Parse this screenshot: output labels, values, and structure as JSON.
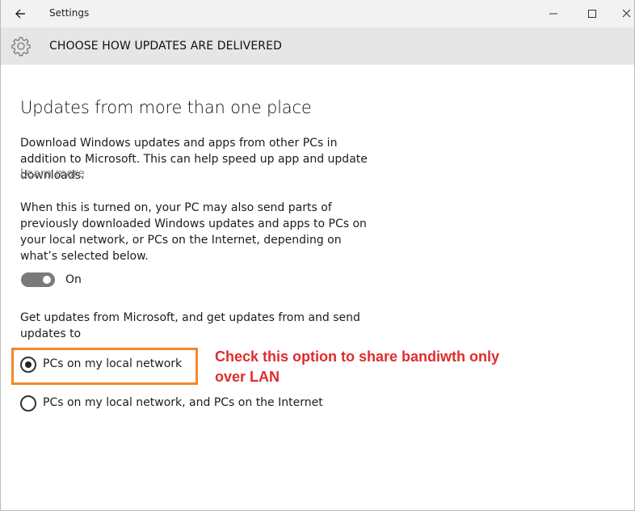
{
  "window": {
    "title": "Settings"
  },
  "icons": {
    "back": "back-arrow-icon",
    "minimize": "minimize-icon",
    "maximize": "maximize-icon",
    "close": "close-icon",
    "settings": "gear-icon"
  },
  "header": {
    "title": "CHOOSE HOW UPDATES ARE DELIVERED"
  },
  "content": {
    "heading": "Updates from more than one place",
    "description": "Download Windows updates and apps from other PCs in addition to Microsoft. This can help speed up app and update downloads.",
    "learn_more": "Learn more",
    "send_note": "When this is turned on, your PC may also send parts of previously downloaded Windows updates and apps to PCs on your local network, or PCs on the Internet, depending on what’s selected below.",
    "toggle": {
      "state": "On",
      "checked": true
    },
    "options_intro": "Get updates from Microsoft, and get updates from and send updates to",
    "options": [
      {
        "label": "PCs on my local network",
        "selected": true
      },
      {
        "label": "PCs on my local network, and PCs on the Internet",
        "selected": false
      }
    ]
  },
  "annotation": {
    "text": "Check this option to share bandiwth only over LAN",
    "color": "#e02b2b",
    "box_color": "#f08a2b"
  },
  "colors": {
    "titlebar_bg": "#f2f2f2",
    "header_bg": "#e6e6e6",
    "toggle_on": "#7a7a7a",
    "link": "#8a8a8a"
  }
}
